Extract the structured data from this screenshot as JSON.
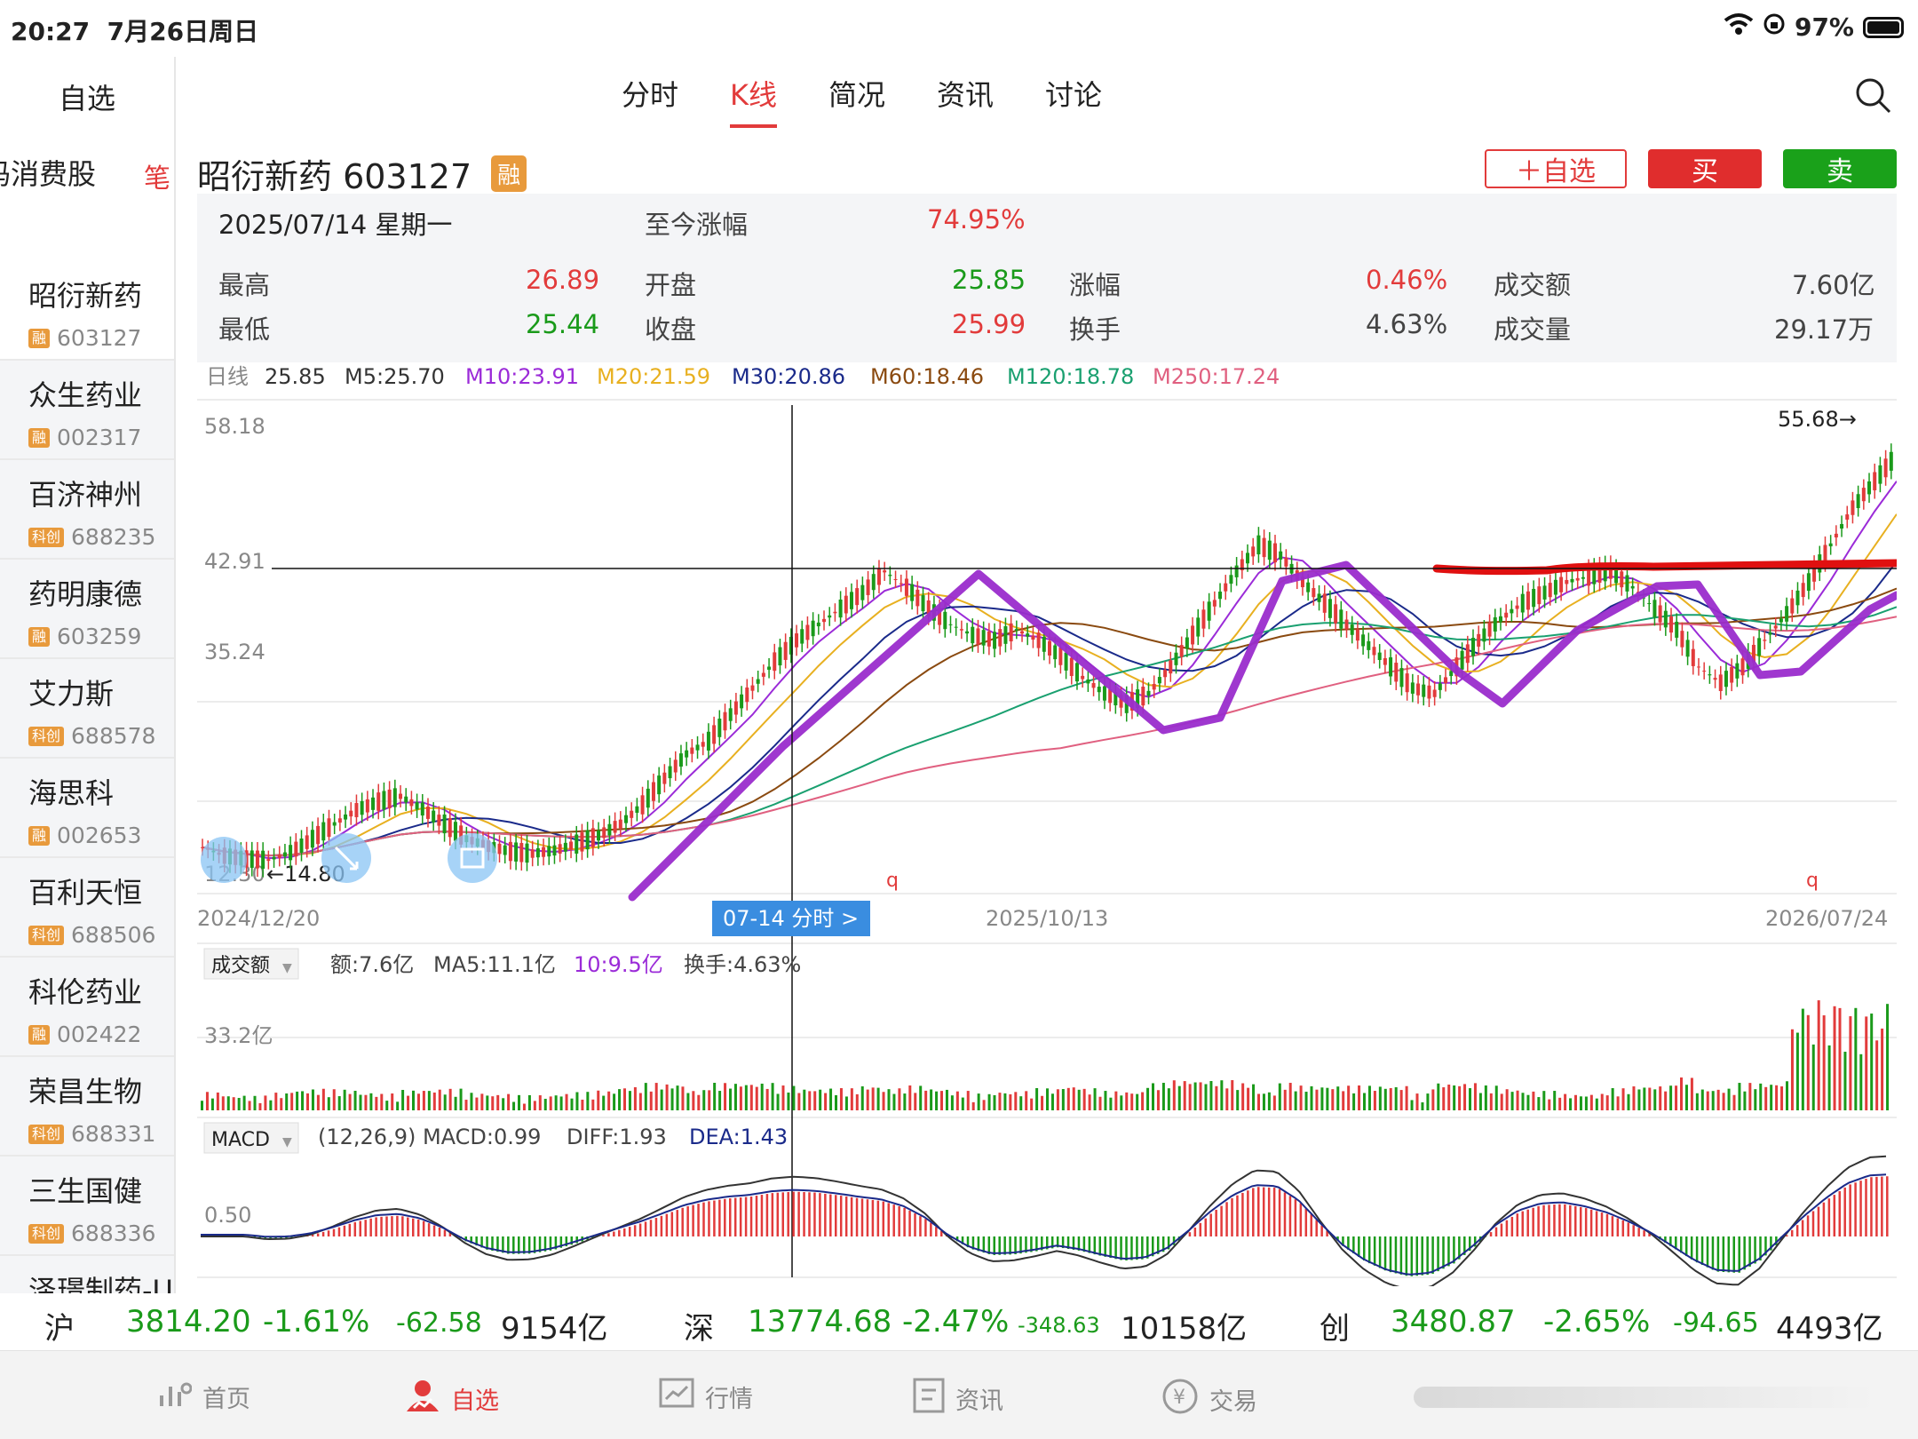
{
  "status": {
    "time": "20:27",
    "date": "7月26日周日",
    "battery": "97%"
  },
  "sidebar": {
    "header": "自选",
    "category": "码消费股",
    "items": [
      {
        "name": "昭衍新药",
        "badge": "融",
        "code": "603127"
      },
      {
        "name": "众生药业",
        "badge": "融",
        "code": "002317"
      },
      {
        "name": "百济神州",
        "badge": "科创",
        "code": "688235"
      },
      {
        "name": "药明康德",
        "badge": "融",
        "code": "603259"
      },
      {
        "name": "艾力斯",
        "badge": "科创",
        "code": "688578"
      },
      {
        "name": "海思科",
        "badge": "融",
        "code": "002653"
      },
      {
        "name": "百利天恒",
        "badge": "科创",
        "code": "688506"
      },
      {
        "name": "科伦药业",
        "badge": "融",
        "code": "002422"
      },
      {
        "name": "荣昌生物",
        "badge": "科创",
        "code": "688331"
      },
      {
        "name": "三生国健",
        "badge": "科创",
        "code": "688336"
      },
      {
        "name": "泽璟制药-U",
        "badge": "",
        "code": ""
      }
    ]
  },
  "tabs": [
    "分时",
    "K线",
    "简况",
    "资讯",
    "讨论"
  ],
  "stock": {
    "name": "昭衍新药 603127",
    "badge": "融"
  },
  "buttons": {
    "add": "＋自选",
    "buy": "买",
    "sell": "卖"
  },
  "quote": {
    "date": "2025/07/14  星期一",
    "since_label": "至今涨幅",
    "since_value": "74.95%",
    "high_label": "最高",
    "high": "26.89",
    "low_label": "最低",
    "low": "25.44",
    "open_label": "开盘",
    "open": "25.85",
    "close_label": "收盘",
    "close": "25.99",
    "chg_label": "涨幅",
    "chg": "0.46%",
    "turn_label": "换手",
    "turn": "4.63%",
    "amt_label": "成交额",
    "amt": "7.60亿",
    "vol_label": "成交量",
    "vol": "29.17万"
  },
  "ma": {
    "period": "日线",
    "price": "25.85",
    "m5": "M5:25.70",
    "m10": "M10:23.91",
    "m20": "M20:21.59",
    "m30": "M30:20.86",
    "m60": "M60:18.46",
    "m120": "M120:18.78",
    "m250": "M250:17.24"
  },
  "colors": {
    "red": "#e23b3b",
    "green": "#1a9a1a",
    "m5": "#333333",
    "m10": "#9b2bd8",
    "m20": "#e8b020",
    "m30": "#1a2a8a",
    "m60": "#8a4a10",
    "m120": "#1aa070",
    "m250": "#e06080",
    "annotation": "#9a2ccc"
  },
  "chart_data": {
    "type": "line",
    "title": "",
    "price_ticks": [
      "58.18",
      "42.91",
      "35.24",
      "12.30"
    ],
    "ylim": [
      12.3,
      58.18
    ],
    "crosshair_price": "42.91",
    "max_label": "55.68→",
    "min_label": "←14.80",
    "x_labels": {
      "start": "2024/12/20",
      "cross": "07-14 分时 >",
      "mid": "2025/10/13",
      "end": "2026/07/24"
    },
    "close_series": [
      16,
      15.2,
      14.9,
      14.8,
      15.5,
      16.8,
      18.2,
      19.5,
      20.3,
      20.8,
      19.6,
      18.2,
      16.8,
      16.1,
      15.6,
      15.4,
      15.7,
      16.3,
      17.1,
      18.2,
      20,
      22.5,
      24.8,
      26,
      28.5,
      31,
      33.5,
      35.5,
      37,
      38.5,
      40,
      42,
      40.5,
      38.5,
      37,
      36,
      35.5,
      36.5,
      35.5,
      34,
      32,
      30.5,
      29.5,
      30.5,
      33,
      36,
      39,
      42,
      44.5,
      43.5,
      41,
      39,
      37,
      35,
      33,
      31,
      30.5,
      33,
      35.5,
      37.5,
      39,
      40,
      41,
      41.5,
      42,
      40.5,
      38.5,
      36.5,
      33,
      31.5,
      33,
      35.5,
      38,
      41,
      44.5,
      48,
      50.5,
      53
    ]
  },
  "volume": {
    "label": "成交额",
    "amt": "额:7.6亿",
    "ma5": "MA5:11.1亿",
    "ma10": "10:9.5亿",
    "turn": "换手:4.63%",
    "tick": "33.2亿"
  },
  "macd": {
    "label": "MACD",
    "params": "(12,26,9) MACD:0.99",
    "diff": "DIFF:1.93",
    "dea": "DEA:1.43",
    "tick": "0.50"
  },
  "ticker": {
    "sh_label": "沪",
    "sh_price": "3814.20",
    "sh_pct": "-1.61%",
    "sh_chg": "-62.58",
    "sh_amt": "9154亿",
    "sz_label": "深",
    "sz_price": "13774.68",
    "sz_pct": "-2.47%",
    "sz_chg": "-348.63",
    "sz_amt": "10158亿",
    "cy_label": "创",
    "cy_price": "3480.87",
    "cy_pct": "-2.65%",
    "cy_chg": "-94.65",
    "cy_amt": "4493亿"
  },
  "nav": [
    "首页",
    "自选",
    "行情",
    "资讯",
    "交易"
  ]
}
